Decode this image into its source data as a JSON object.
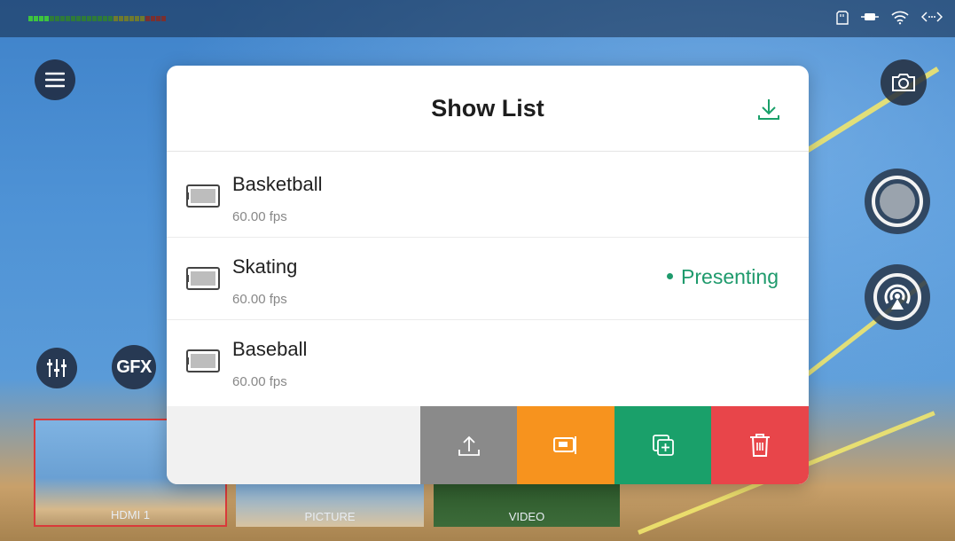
{
  "app": {
    "status_icons": [
      "sd-card-icon",
      "battery-icon",
      "wifi-icon",
      "connection-icon"
    ],
    "buttons": {
      "gfx_label": "GFX"
    },
    "sources": [
      {
        "label": "HDMI 1",
        "selected": true
      },
      {
        "label": "PICTURE",
        "selected": false
      },
      {
        "label": "VIDEO",
        "selected": false
      }
    ]
  },
  "show_list": {
    "title": "Show List",
    "items": [
      {
        "name": "Basketball",
        "fps": "60.00 fps",
        "status": ""
      },
      {
        "name": "Skating",
        "fps": "60.00 fps",
        "status": "Presenting"
      },
      {
        "name": "Baseball",
        "fps": "60.00 fps",
        "status": ""
      }
    ],
    "actions": [
      "upload-icon",
      "present-icon",
      "duplicate-icon",
      "delete-icon"
    ]
  },
  "colors": {
    "presenting": "#1e9a6c",
    "upload": "#8a8a8a",
    "present": "#f7931e",
    "duplicate": "#1aa06a",
    "delete": "#e8454a",
    "selected_source_border": "#d93a3a"
  }
}
